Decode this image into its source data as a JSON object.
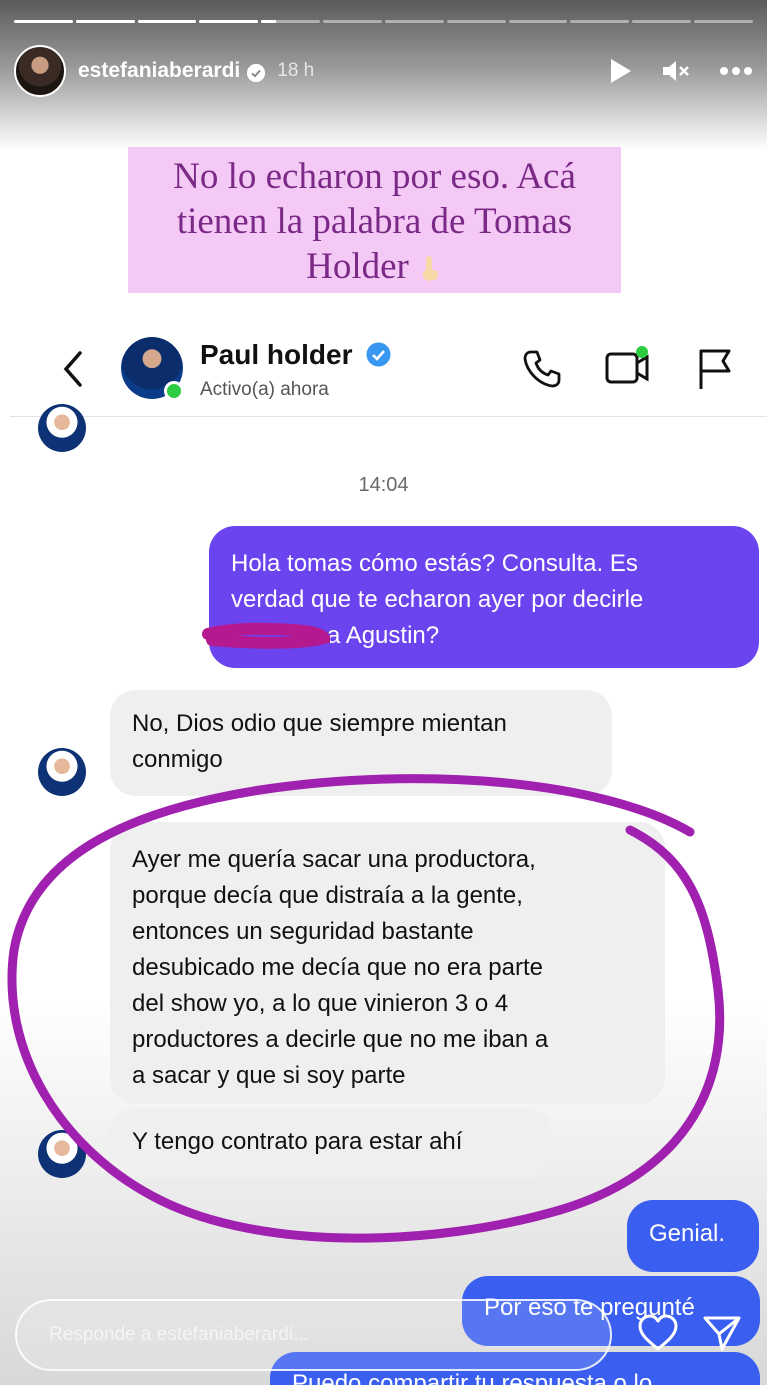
{
  "story": {
    "username": "estefaniaberardi",
    "time_ago": "18 h",
    "progress_segments": [
      1,
      1,
      1,
      1,
      0.25,
      0,
      0,
      0,
      0,
      0,
      0,
      0
    ],
    "caption_line1": "No lo echaron por eso. Acá",
    "caption_line2": "tienen la palabra de Tomas",
    "caption_line3": "Holder",
    "caption_color": "#7a2a86",
    "caption_bg": "#f5c9f6",
    "reply_placeholder": "Responde a estefaniaberardi...",
    "icons": [
      "play-icon",
      "mute-icon",
      "more-icon",
      "heart-icon",
      "send-icon"
    ]
  },
  "dm": {
    "name": "Paul holder",
    "status": "Activo(a) ahora",
    "icons": [
      "back-icon",
      "phone-icon",
      "video-icon",
      "flag-icon"
    ]
  },
  "chat": {
    "timestamp": "14:04",
    "outgoing_color": "#6b44f0",
    "messages": [
      {
        "side": "out",
        "lines": [
          "Hola tomas cómo estás? Consulta. Es",
          "verdad que te echaron ayer por decirle",
          "a Agustin?"
        ]
      },
      {
        "side": "in",
        "lines": [
          "No, Dios odio que siempre mientan",
          "conmigo"
        ]
      },
      {
        "side": "in",
        "lines": [
          "Ayer me quería sacar una productora,",
          "porque decía que distraía a la gente,",
          "entonces un seguridad bastante",
          "desubicado me decía que no era parte",
          "del show yo, a lo que vinieron 3 o 4",
          "productores a decirle que no me iban a",
          "a sacar y que si soy parte"
        ]
      },
      {
        "side": "in",
        "lines": [
          "Y tengo contrato para estar ahí"
        ]
      },
      {
        "side": "out",
        "lines": [
          "Genial."
        ]
      },
      {
        "side": "out",
        "lines": [
          "Por eso te pregunté"
        ]
      },
      {
        "side": "out",
        "lines": [
          "Puedo compartir tu respuesta o lo"
        ]
      }
    ]
  },
  "annotation_color": "#a020b0"
}
